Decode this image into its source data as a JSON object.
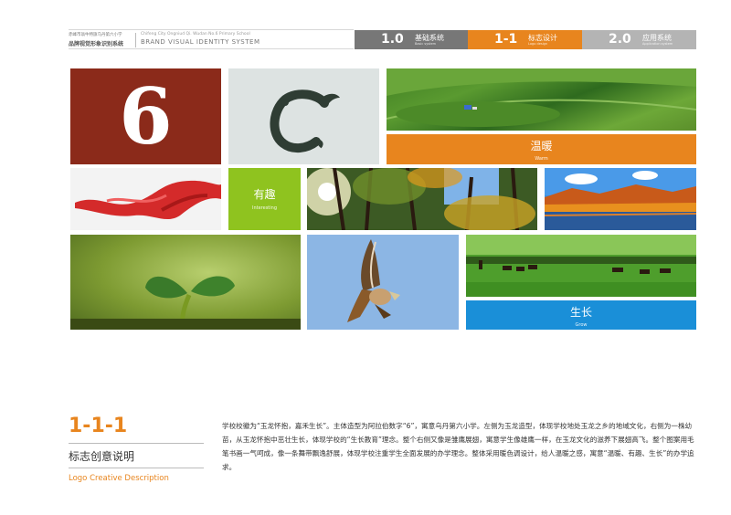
{
  "header": {
    "school_cn": "赤峰市翁牛特旗乌丹第六小学",
    "brand_cn": "品牌视觉形象识别系统",
    "school_en": "Chifeng City Ongniud Qi. Wudan No.6 Primary School",
    "brand_en": "BRAND VISUAL IDENTITY SYSTEM",
    "tabs": [
      {
        "num": "1.0",
        "cn": "基础系统",
        "en": "Basic system",
        "color": "#777777"
      },
      {
        "num": "1-1",
        "cn": "标志设计",
        "en": "Logo design",
        "color": "#e8851e"
      },
      {
        "num": "2.0",
        "cn": "应用系统",
        "en": "Application system",
        "color": "#b4b4b4"
      }
    ]
  },
  "tiles": {
    "six": "6",
    "warm": {
      "cn": "温暖",
      "en": "Warm",
      "color": "#e8851e"
    },
    "interesting": {
      "cn": "有趣",
      "en": "Interesting",
      "color": "#8fc31f"
    },
    "grow": {
      "cn": "生长",
      "en": "Grow",
      "color": "#1a8fd8"
    }
  },
  "section": {
    "number": "1-1-1",
    "title_cn": "标志创意说明",
    "title_en": "Logo Creative Description",
    "description": "学校校徽为“玉龙怀抱，嘉禾生长”。主体造型为阿拉伯数字“6”，寓意乌丹第六小学。左侧为玉龙造型，体现学校地处玉龙之乡的地域文化，右侧为一株幼苗，从玉龙怀抱中茁壮生长，体现学校的“生长教育”理念。整个右侧又像是雏鹰展翅，寓意学生像雄鹰一样，在玉龙文化的滋养下展翅高飞。整个图案用毛笔书画一气呵成，像一条舞带飘逸舒展，体现学校注重学生全面发展的办学理念。整体采用暖色调设计，给人温暖之感，寓意“温暖、有趣、生长”的办学追求。"
  }
}
